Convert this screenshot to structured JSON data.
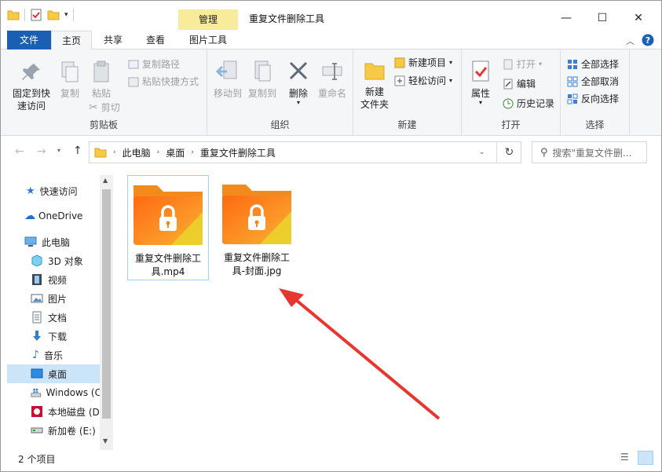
{
  "window": {
    "title": "重复文件删除工具",
    "context_tab": "管理",
    "minimize": "—",
    "maximize": "☐",
    "close": "✕"
  },
  "tabs": [
    "文件",
    "主页",
    "共享",
    "查看",
    "图片工具"
  ],
  "ribbon": {
    "clipboard": {
      "label": "剪贴板",
      "pin": "固定到快\n速访问",
      "pin_l1": "固定到快",
      "pin_l2": "速访问",
      "copy": "复制",
      "paste": "粘贴",
      "copy_path": "复制路径",
      "paste_shortcut": "粘贴快捷方式",
      "cut": "剪切"
    },
    "organize": {
      "label": "组织",
      "move_to": "移动到",
      "copy_to": "复制到",
      "delete": "删除",
      "rename": "重命名"
    },
    "new": {
      "label": "新建",
      "new_folder_l1": "新建",
      "new_folder_l2": "文件夹",
      "new_item": "新建项目",
      "easy_access": "轻松访问"
    },
    "open": {
      "label": "打开",
      "properties": "属性",
      "open": "打开",
      "edit": "编辑",
      "history": "历史记录"
    },
    "select": {
      "label": "选择",
      "select_all": "全部选择",
      "select_none": "全部取消",
      "invert": "反向选择"
    }
  },
  "address": {
    "path": [
      "此电脑",
      "桌面",
      "重复文件删除工具"
    ],
    "search_placeholder": "搜索\"重复文件删..."
  },
  "nav": {
    "quick_access": "快速访问",
    "onedrive": "OneDrive",
    "this_pc": "此电脑",
    "items": [
      "3D 对象",
      "视频",
      "图片",
      "文档",
      "下载",
      "音乐",
      "桌面",
      "Windows (C",
      "本地磁盘 (D",
      "新加卷 (E:)"
    ]
  },
  "files": [
    {
      "name_l1": "重复文件删除工",
      "name_l2": "具.mp4"
    },
    {
      "name_l1": "重复文件删除工",
      "name_l2": "具-封面.jpg"
    }
  ],
  "status": {
    "count": "2 个项目"
  },
  "colors": {
    "accent": "#1a5fb4",
    "context_tab": "#f9eb9c",
    "arrow": "#e8362e",
    "folder": "#f7901e",
    "selection": "#cce4f7"
  }
}
